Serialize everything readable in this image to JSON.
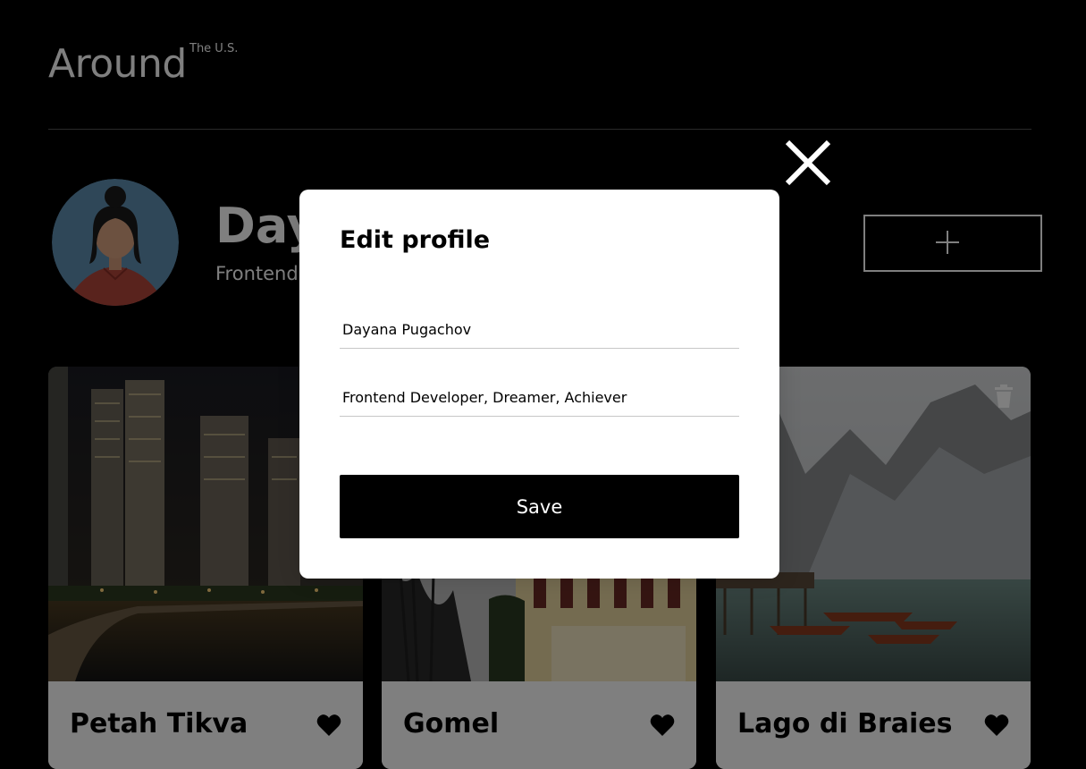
{
  "header": {
    "logo": "Around",
    "logo_suffix": "The U.S."
  },
  "profile": {
    "name": "Dayana Pugachov",
    "about": "Frontend Developer, Dreamer, Achiever",
    "add_button_icon": "plus-icon"
  },
  "cards": [
    {
      "title": "Petah Tikva",
      "icon": "heart-icon"
    },
    {
      "title": "Gomel",
      "icon": "heart-icon"
    },
    {
      "title": "Lago di Braies",
      "icon": "heart-icon",
      "delete_icon": "trash-icon"
    }
  ],
  "modal": {
    "title": "Edit profile",
    "name_value": "Dayana Pugachov",
    "about_value": "Frontend Developer, Dreamer, Achiever",
    "save_label": "Save",
    "close_icon": "close-icon"
  },
  "colors": {
    "background": "#000000",
    "modal": "#ffffff",
    "button": "#000000",
    "overlay": "rgba(0,0,0,0.5)"
  }
}
